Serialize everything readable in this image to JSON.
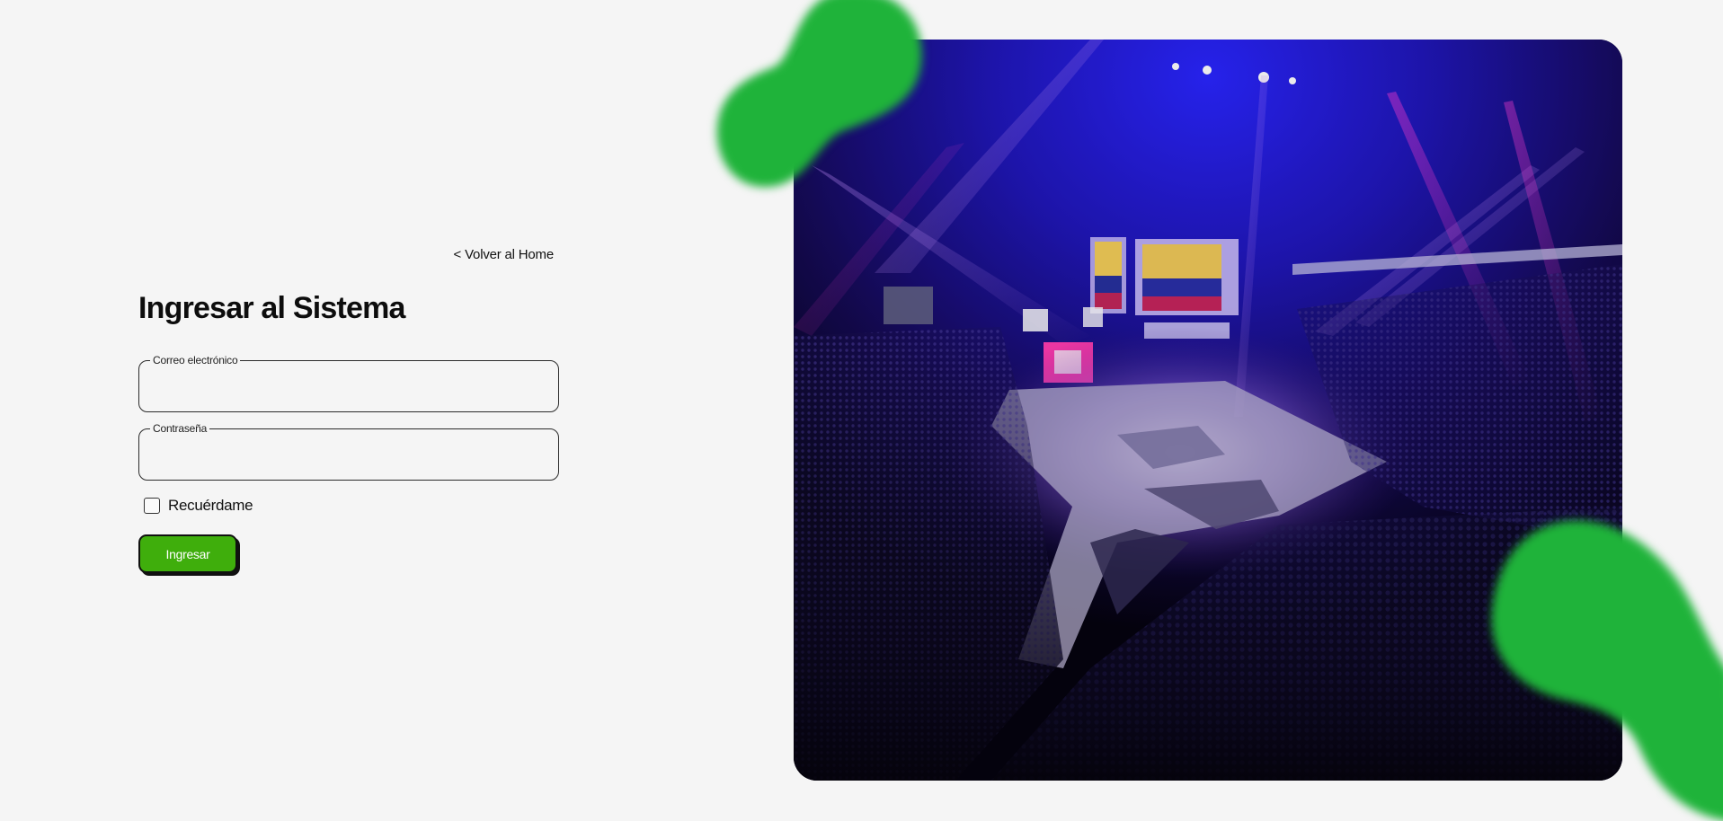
{
  "login": {
    "back_link": "< Volver al Home",
    "title": "Ingresar al Sistema",
    "email": {
      "label": "Correo electrónico",
      "value": ""
    },
    "password": {
      "label": "Contraseña",
      "value": ""
    },
    "remember": {
      "label": "Recuérdame",
      "checked": false
    },
    "submit_label": "Ingresar"
  },
  "colors": {
    "page_background": "#f5f5f5",
    "button_green": "#3fae0c",
    "blob_green": "#1fb33a",
    "hero_purple": "#6a1fd0",
    "hero_blue": "#1a1aff"
  },
  "hero": {
    "content": "arena-concert-photo"
  }
}
